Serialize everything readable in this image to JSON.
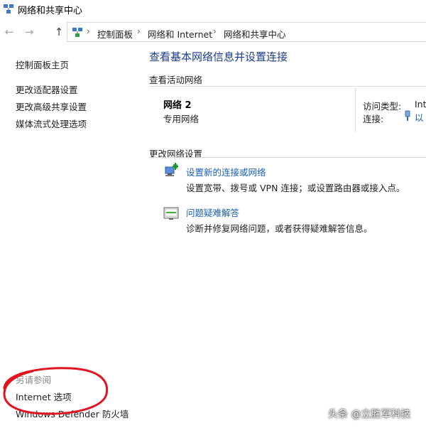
{
  "window": {
    "title": "网络和共享中心"
  },
  "nav": {
    "back": "←",
    "forward": "→",
    "up": "↑"
  },
  "breadcrumbs": [
    {
      "label": "控制面板"
    },
    {
      "label": "网络和 Internet"
    },
    {
      "label": "网络和共享中心"
    }
  ],
  "breadcrumb_separator": "›",
  "sidebar": {
    "items": [
      {
        "label": "控制面板主页"
      },
      {
        "label": "更改适配器设置"
      },
      {
        "label": "更改高级共享设置"
      },
      {
        "label": "媒体流式处理选项"
      }
    ],
    "see_also": {
      "heading": "另请参阅",
      "items": [
        {
          "label": "Internet 选项"
        },
        {
          "label": "Windows Defender 防火墙"
        }
      ]
    }
  },
  "main": {
    "heading": "查看基本网络信息并设置连接",
    "active_networks": {
      "label": "查看活动网络",
      "network_name": "网络 2",
      "network_type": "专用网络",
      "access_type_label": "访问类型:",
      "access_type_value": "Int",
      "connections_label": "连接:",
      "connections_value": "以"
    },
    "change_settings": {
      "label": "更改网络设置",
      "tasks": [
        {
          "icon": "network-setup-icon",
          "title": "设置新的连接或网络",
          "description": "设置宽带、拨号或 VPN 连接；或设置路由器或接入点。"
        },
        {
          "icon": "troubleshoot-icon",
          "title": "问题疑难解答",
          "description": "诊断并修复网络问题，或者获得疑难解答信息。"
        }
      ]
    }
  },
  "watermark": "头条 @立胜军科技",
  "colors": {
    "link": "#1a5fb4",
    "heading": "#1a3d8f",
    "annotation": "#e0141e"
  }
}
